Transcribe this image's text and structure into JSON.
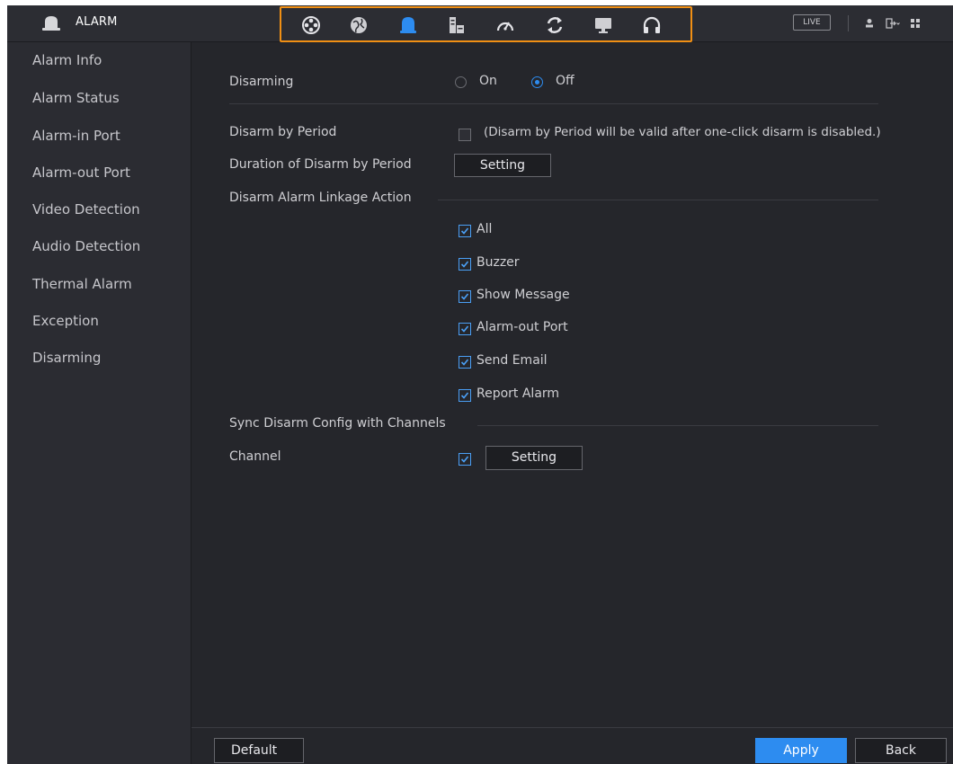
{
  "app": {
    "title": "ALARM"
  },
  "topbar": {
    "nav_icons": [
      "camera-icon",
      "network-icon",
      "alarm-icon",
      "storage-icon",
      "performance-icon",
      "backup-icon",
      "display-icon",
      "audio-icon"
    ],
    "active_nav": "alarm-icon",
    "live_label": "LIVE",
    "highlight_color": "#f08f14"
  },
  "sidebar": {
    "items": [
      {
        "label": "Alarm Info"
      },
      {
        "label": "Alarm Status"
      },
      {
        "label": "Alarm-in Port"
      },
      {
        "label": "Alarm-out Port"
      },
      {
        "label": "Video Detection"
      },
      {
        "label": "Audio Detection"
      },
      {
        "label": "Thermal Alarm"
      },
      {
        "label": "Exception"
      },
      {
        "label": "Disarming"
      }
    ]
  },
  "form": {
    "disarming": {
      "label": "Disarming",
      "on_label": "On",
      "off_label": "Off",
      "value": "Off"
    },
    "disarm_by_period": {
      "label": "Disarm by Period",
      "checked": false,
      "note": "(Disarm by Period will be valid after one-click disarm is disabled.)"
    },
    "duration": {
      "label": "Duration of Disarm by Period",
      "button": "Setting"
    },
    "linkage": {
      "label": "Disarm Alarm Linkage Action",
      "options": [
        {
          "label": "All",
          "checked": true
        },
        {
          "label": "Buzzer",
          "checked": true
        },
        {
          "label": "Show Message",
          "checked": true
        },
        {
          "label": "Alarm-out Port",
          "checked": true
        },
        {
          "label": "Send Email",
          "checked": true
        },
        {
          "label": "Report Alarm",
          "checked": true
        }
      ]
    },
    "sync": {
      "label": "Sync Disarm Config with Channels"
    },
    "channel": {
      "label": "Channel",
      "checked": true,
      "button": "Setting"
    }
  },
  "footer": {
    "default": "Default",
    "apply": "Apply",
    "back": "Back"
  },
  "colors": {
    "accent": "#2d8cf0",
    "background": "#25262b",
    "sidebar": "#2b2c32"
  }
}
